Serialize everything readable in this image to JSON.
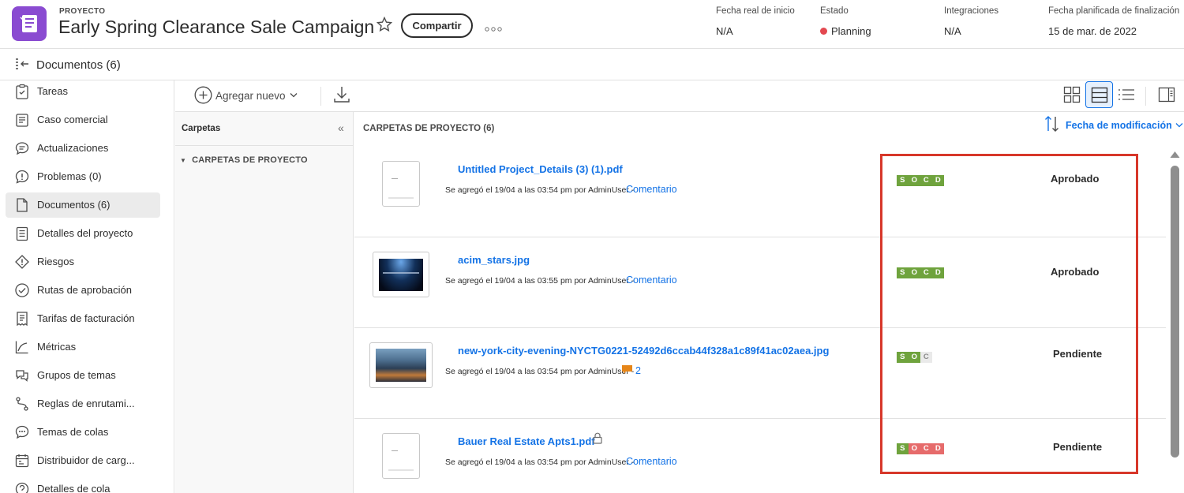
{
  "header": {
    "eyebrow": "PROYECTO",
    "title": "Early Spring Clearance Sale Campaign",
    "share_label": "Compartir",
    "fields": [
      {
        "label": "Fecha real de inicio",
        "value": "N/A"
      },
      {
        "label": "Estado",
        "value": "Planning"
      },
      {
        "label": "Integraciones",
        "value": "N/A"
      },
      {
        "label": "Fecha planificada de finalización",
        "value": "15 de mar. de 2022"
      }
    ]
  },
  "docbar": {
    "title": "Documentos (6)"
  },
  "sidebar": {
    "items": [
      {
        "label": "Tareas",
        "icon": "tasks-icon"
      },
      {
        "label": "Caso comercial",
        "icon": "business-case-icon"
      },
      {
        "label": "Actualizaciones",
        "icon": "updates-icon"
      },
      {
        "label": "Problemas (0)",
        "icon": "issues-icon"
      },
      {
        "label": "Documentos (6)",
        "icon": "document-icon"
      },
      {
        "label": "Detalles del proyecto",
        "icon": "details-icon"
      },
      {
        "label": "Riesgos",
        "icon": "risks-icon"
      },
      {
        "label": "Rutas de aprobación",
        "icon": "approvals-icon"
      },
      {
        "label": "Tarifas de facturación",
        "icon": "billing-icon"
      },
      {
        "label": "Métricas",
        "icon": "metrics-icon"
      },
      {
        "label": "Grupos de temas",
        "icon": "topic-groups-icon"
      },
      {
        "label": "Reglas de enrutami...",
        "icon": "routing-icon"
      },
      {
        "label": "Temas de colas",
        "icon": "queue-topics-icon"
      },
      {
        "label": "Distribuidor de carg...",
        "icon": "workload-icon"
      },
      {
        "label": "Detalles de cola",
        "icon": "queue-details-icon"
      }
    ]
  },
  "toolbar": {
    "add_new_label": "Agregar nuevo"
  },
  "folders": {
    "header": "Carpetas",
    "project_folders": "CARPETAS DE PROYECTO"
  },
  "main": {
    "header": "CARPETAS DE PROYECTO (6)",
    "sort_label": "Fecha de modificación",
    "documents": [
      {
        "name": "Untitled Project_Details (3) (1).pdf",
        "added": "Se agregó el 19/04 a las 03:54 pm por AdminUser -",
        "comment": "Comentario",
        "status": "Aprobado",
        "socd": [
          {
            "letter": "S",
            "state": "g"
          },
          {
            "letter": "O",
            "state": "g"
          },
          {
            "letter": "C",
            "state": "g"
          },
          {
            "letter": "D",
            "state": "g"
          }
        ]
      },
      {
        "name": "acim_stars.jpg",
        "added": "Se agregó el 19/04 a las 03:55 pm por AdminUser -",
        "comment": "Comentario",
        "status": "Aprobado",
        "socd": [
          {
            "letter": "S",
            "state": "g"
          },
          {
            "letter": "O",
            "state": "g"
          },
          {
            "letter": "C",
            "state": "g"
          },
          {
            "letter": "D",
            "state": "g"
          }
        ]
      },
      {
        "name": "new-york-city-evening-NYCTG0221-52492d6ccab44f328a1c89f41ac02aea.jpg",
        "added": "Se agregó el 19/04 a las 03:54 pm por AdminUser -",
        "comment": "2",
        "status": "Pendiente",
        "socd": [
          {
            "letter": "S",
            "state": "g"
          },
          {
            "letter": "O",
            "state": "g"
          },
          {
            "letter": "C",
            "state": "e"
          }
        ]
      },
      {
        "name": "Bauer Real Estate Apts1.pdf",
        "added": "Se agregó el 19/04 a las 03:54 pm por AdminUser -",
        "comment": "Comentario",
        "status": "Pendiente",
        "socd": [
          {
            "letter": "S",
            "state": "g"
          },
          {
            "letter": "O",
            "state": "r"
          },
          {
            "letter": "C",
            "state": "r"
          },
          {
            "letter": "D",
            "state": "r"
          }
        ]
      }
    ]
  },
  "colors": {
    "accent": "#1473e6",
    "brand": "#8a4bd1",
    "status_red": "#e34850",
    "highlight": "#d7372a"
  }
}
